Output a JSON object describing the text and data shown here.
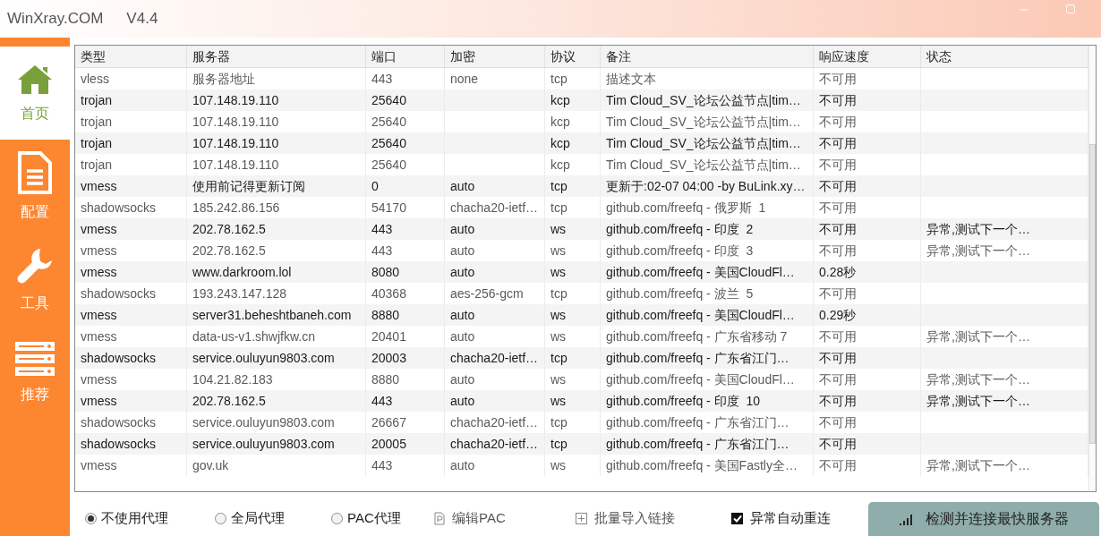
{
  "window": {
    "title": "WinXray.COM",
    "version": "V4.4"
  },
  "sidebar": {
    "items": [
      {
        "label": "首页",
        "kind": "home",
        "selected": true
      },
      {
        "label": "配置",
        "kind": "document",
        "selected": false
      },
      {
        "label": "工具",
        "kind": "wrench",
        "selected": false
      },
      {
        "label": "推荐",
        "kind": "server",
        "selected": false
      }
    ]
  },
  "table": {
    "columns": [
      "类型",
      "服务器",
      "端口",
      "加密",
      "协议",
      "备注",
      "响应速度",
      "状态"
    ],
    "rows": [
      {
        "type": "vless",
        "server": "服务器地址",
        "port": "443",
        "encryption": "none",
        "protocol": "tcp",
        "remark": "描述文本",
        "speed": "不可用"
      },
      {
        "type": "trojan",
        "server": "107.148.19.110",
        "port": "25640",
        "protocol": "kcp",
        "remark": "Tim Cloud_SV_论坛公益节点|tim…",
        "speed": "不可用"
      },
      {
        "type": "trojan",
        "server": "107.148.19.110",
        "port": "25640",
        "protocol": "kcp",
        "remark": "Tim Cloud_SV_论坛公益节点|tim…",
        "speed": "不可用"
      },
      {
        "type": "trojan",
        "server": "107.148.19.110",
        "port": "25640",
        "protocol": "kcp",
        "remark": "Tim Cloud_SV_论坛公益节点|tim…",
        "speed": "不可用"
      },
      {
        "type": "trojan",
        "server": "107.148.19.110",
        "port": "25640",
        "protocol": "kcp",
        "remark": "Tim Cloud_SV_论坛公益节点|tim…",
        "speed": "不可用"
      },
      {
        "type": "vmess",
        "server": "使用前记得更新订阅",
        "port": "0",
        "encryption": "auto",
        "protocol": "tcp",
        "remark": "更新于:02-07 04:00 -by BuLink.xy…",
        "speed": "不可用"
      },
      {
        "type": "shadowsocks",
        "server": "185.242.86.156",
        "port": "54170",
        "encryption": "chacha20-ietf…",
        "protocol": "tcp",
        "remark": "github.com/freefq - 俄罗斯  1",
        "speed": "不可用"
      },
      {
        "type": "vmess",
        "server": "202.78.162.5",
        "port": "443",
        "encryption": "auto",
        "protocol": "ws",
        "remark": "github.com/freefq - 印度  2",
        "speed": "不可用",
        "status": "异常,测试下一个…"
      },
      {
        "type": "vmess",
        "server": "202.78.162.5",
        "port": "443",
        "encryption": "auto",
        "protocol": "ws",
        "remark": "github.com/freefq - 印度  3",
        "speed": "不可用",
        "status": "异常,测试下一个…"
      },
      {
        "type": "vmess",
        "server": "www.darkroom.lol",
        "port": "8080",
        "encryption": "auto",
        "protocol": "ws",
        "remark": "github.com/freefq - 美国CloudFl…",
        "speed": "0.28秒"
      },
      {
        "type": "shadowsocks",
        "server": "193.243.147.128",
        "port": "40368",
        "encryption": "aes-256-gcm",
        "protocol": "tcp",
        "remark": "github.com/freefq - 波兰  5",
        "speed": "不可用"
      },
      {
        "type": "vmess",
        "server": "server31.beheshtbaneh.com",
        "port": "8880",
        "encryption": "auto",
        "protocol": "ws",
        "remark": "github.com/freefq - 美国CloudFl…",
        "speed": "0.29秒"
      },
      {
        "type": "vmess",
        "server": "data-us-v1.shwjfkw.cn",
        "port": "20401",
        "encryption": "auto",
        "protocol": "ws",
        "remark": "github.com/freefq - 广东省移动 7",
        "speed": "不可用",
        "status": "异常,测试下一个…"
      },
      {
        "type": "shadowsocks",
        "server": "service.ouluyun9803.com",
        "port": "20003",
        "encryption": "chacha20-ietf…",
        "protocol": "tcp",
        "remark": "github.com/freefq - 广东省江门…",
        "speed": "不可用"
      },
      {
        "type": "vmess",
        "server": "104.21.82.183",
        "port": "8880",
        "encryption": "auto",
        "protocol": "ws",
        "remark": "github.com/freefq - 美国CloudFl…",
        "speed": "不可用",
        "status": "异常,测试下一个…"
      },
      {
        "type": "vmess",
        "server": "202.78.162.5",
        "port": "443",
        "encryption": "auto",
        "protocol": "ws",
        "remark": "github.com/freefq - 印度  10",
        "speed": "不可用",
        "status": "异常,测试下一个…"
      },
      {
        "type": "shadowsocks",
        "server": "service.ouluyun9803.com",
        "port": "26667",
        "encryption": "chacha20-ietf…",
        "protocol": "tcp",
        "remark": "github.com/freefq - 广东省江门…",
        "speed": "不可用"
      },
      {
        "type": "shadowsocks",
        "server": "service.ouluyun9803.com",
        "port": "20005",
        "encryption": "chacha20-ietf…",
        "protocol": "tcp",
        "remark": "github.com/freefq - 广东省江门…",
        "speed": "不可用"
      },
      {
        "type": "vmess",
        "server": "gov.uk",
        "port": "443",
        "encryption": "auto",
        "protocol": "ws",
        "remark": "github.com/freefq - 美国Fastly全…",
        "speed": "不可用",
        "status": "异常,测试下一个…"
      }
    ]
  },
  "bottom_bar": {
    "proxy_modes": [
      {
        "label": "不使用代理",
        "selected": true
      },
      {
        "label": "全局代理",
        "selected": false
      },
      {
        "label": "PAC代理",
        "selected": false
      }
    ],
    "edit_pac": "编辑PAC",
    "import_links": "批量导入链接",
    "auto_reconnect": {
      "label": "异常自动重连",
      "checked": true
    },
    "connect_button": "检测并连接最快服务器"
  }
}
